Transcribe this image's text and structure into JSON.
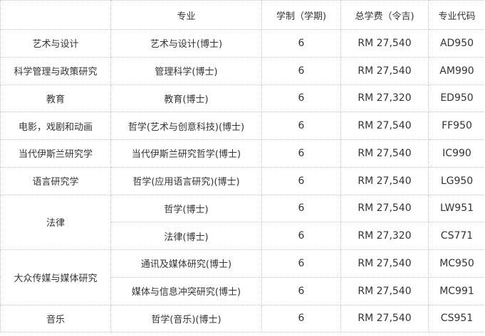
{
  "table": {
    "headers": {
      "faculty": "",
      "major": "专业",
      "duration": "学制（学期)",
      "tuition": "总学费（令吉)",
      "code": "专业代码"
    },
    "faculties": [
      "艺术与设计",
      "科学管理与政策研究",
      "教育",
      "电影，戏剧和动画",
      "当代伊斯兰研究学",
      "语言研究学",
      "法律",
      "大众传媒与媒体研究",
      "音乐"
    ],
    "rows": [
      {
        "major": "艺术与设计(博士)",
        "duration": "6",
        "tuition": "RM 27,540",
        "code": "AD950"
      },
      {
        "major": "管理科学(博士)",
        "duration": "6",
        "tuition": "RM 27,540",
        "code": "AM990"
      },
      {
        "major": "教育(博士)",
        "duration": "6",
        "tuition": "RM 27,320",
        "code": "ED950"
      },
      {
        "major": "哲学(艺术与创意科技)(博士)",
        "duration": "6",
        "tuition": "RM 27,540",
        "code": "FF950"
      },
      {
        "major": "当代伊斯兰研究哲学(博士)",
        "duration": "6",
        "tuition": "RM 27,540",
        "code": "IC990"
      },
      {
        "major": "哲学(应用语言研究)(博士)",
        "duration": "6",
        "tuition": "RM 27,540",
        "code": "LG950"
      },
      {
        "major": "哲学(博士)",
        "duration": "6",
        "tuition": "RM 27,540",
        "code": "LW951"
      },
      {
        "major": "法律(博士)",
        "duration": "6",
        "tuition": "RM 27,320",
        "code": "CS771"
      },
      {
        "major": "通讯及媒体研究(博士)",
        "duration": "6",
        "tuition": "RM 27,540",
        "code": "MC950"
      },
      {
        "major": "媒体与信息冲突研究(博士)",
        "duration": "6",
        "tuition": "RM 27,540",
        "code": "MC991"
      },
      {
        "major": "哲学(音乐)(博士)",
        "duration": "6",
        "tuition": "RM 27,540",
        "code": "CS951"
      }
    ]
  }
}
